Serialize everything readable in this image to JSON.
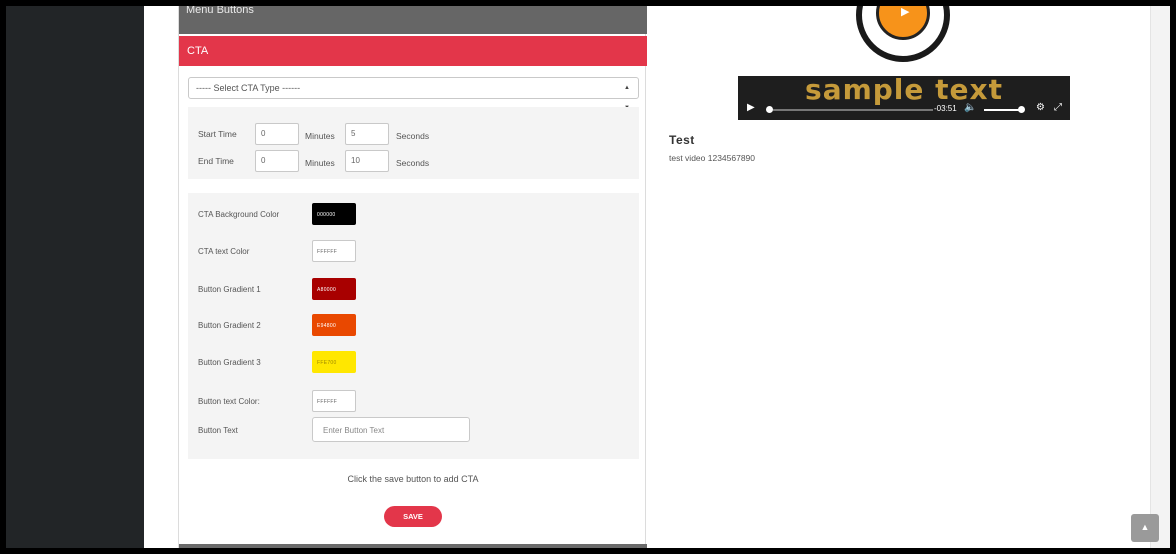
{
  "panel": {
    "menu_buttons_label": "Menu Buttons",
    "cta_header": "CTA",
    "cta_type_select": {
      "selected": "----- Select CTA Type ------"
    },
    "time": {
      "start_label": "Start Time",
      "start_minutes": "0",
      "start_seconds": "5",
      "end_label": "End Time",
      "end_minutes": "0",
      "end_seconds": "10",
      "minutes_unit": "Minutes",
      "seconds_unit": "Seconds"
    },
    "colors": {
      "bg_label": "CTA Background Color",
      "bg_value": "000000",
      "bg_hex": "#000000",
      "text_label": "CTA text Color",
      "text_value": "FFFFFF",
      "text_hex": "#FFFFFF",
      "grad1_label": "Button Gradient 1",
      "grad1_value": "A80000",
      "grad1_hex": "#A80000",
      "grad2_label": "Button Gradient 2",
      "grad2_value": "E94800",
      "grad2_hex": "#E94800",
      "grad3_label": "Button Gradient 3",
      "grad3_value": "FFE700",
      "grad3_hex": "#FFE700",
      "btn_text_color_label": "Button text Color:",
      "btn_text_color_value": "FFFFFF",
      "btn_text_color_hex": "#FFFFFF",
      "btn_text_label": "Button Text",
      "btn_text_placeholder": "Enter Button Text"
    },
    "hint": "Click the save button to add CTA",
    "save_label": "SAVE"
  },
  "video": {
    "overlay_text": "sample text",
    "time_remaining": "-03:51",
    "play_icon": "play-icon",
    "volume_icon": "volume-icon",
    "settings_icon": "gear-icon",
    "fullscreen_icon": "fullscreen-icon",
    "accent": "#f7931a",
    "title": "Test",
    "description": "test video 1234567890"
  },
  "scroll_top_icon": "chevron-up-icon",
  "theme": {
    "primary": "#e3364a",
    "dark_bar": "#666666"
  }
}
